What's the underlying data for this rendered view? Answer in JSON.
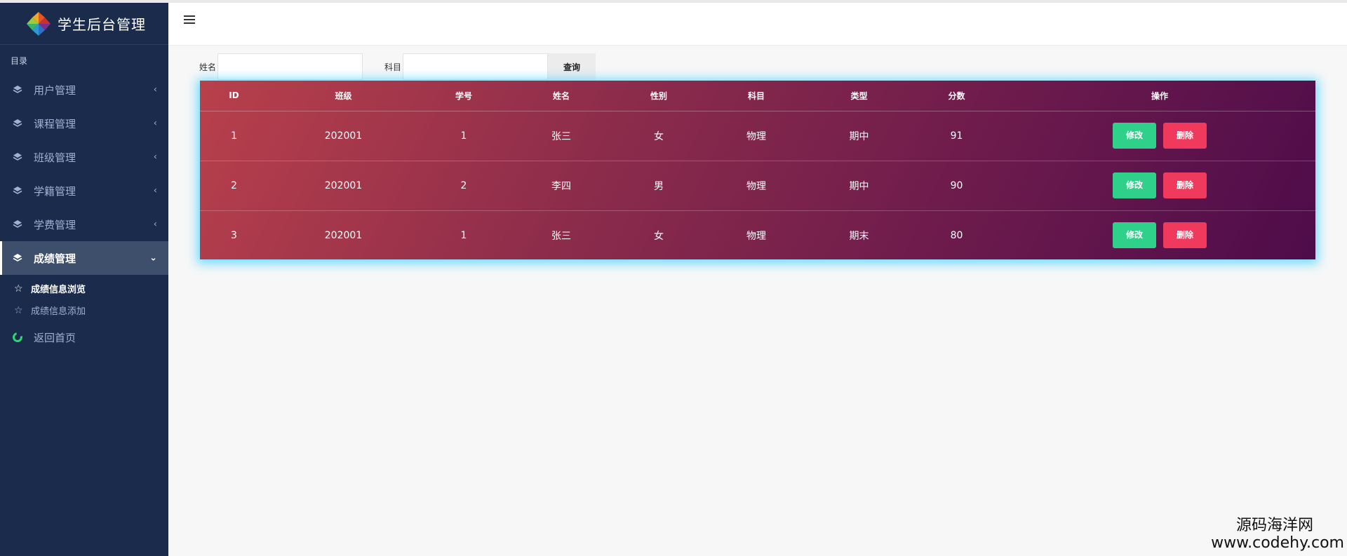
{
  "sidebar": {
    "brand_title": "学生后台管理",
    "menu_heading": "目录",
    "items": [
      {
        "label": "用户管理"
      },
      {
        "label": "课程管理"
      },
      {
        "label": "班级管理"
      },
      {
        "label": "学籍管理"
      },
      {
        "label": "学费管理"
      },
      {
        "label": "成绩管理"
      }
    ],
    "sub_items": [
      {
        "label": "成绩信息浏览"
      },
      {
        "label": "成绩信息添加"
      }
    ],
    "back_home": "返回首页"
  },
  "search": {
    "name_label": "姓名",
    "name_value": "",
    "subject_label": "科目",
    "subject_value": "",
    "query_button": "查询"
  },
  "table": {
    "headers": [
      "ID",
      "班级",
      "学号",
      "姓名",
      "性别",
      "科目",
      "类型",
      "分数",
      "操作"
    ],
    "rows": [
      {
        "id": "1",
        "class": "202001",
        "student_no": "1",
        "name": "张三",
        "gender": "女",
        "subject": "物理",
        "type": "期中",
        "score": "91"
      },
      {
        "id": "2",
        "class": "202001",
        "student_no": "2",
        "name": "李四",
        "gender": "男",
        "subject": "物理",
        "type": "期中",
        "score": "90"
      },
      {
        "id": "3",
        "class": "202001",
        "student_no": "1",
        "name": "张三",
        "gender": "女",
        "subject": "物理",
        "type": "期末",
        "score": "80"
      }
    ],
    "edit_label": "修改",
    "delete_label": "删除"
  },
  "watermark": {
    "cn": "源码海洋网",
    "url": "www.codehy.com"
  },
  "colors": {
    "sidebar_bg": "#1b2b4b",
    "edit_button": "#2ed08a",
    "delete_button": "#ef3a5d",
    "table_gradient_start": "#b8404b",
    "table_gradient_end": "#4e0c4a",
    "table_glow": "#40d2ff"
  },
  "icons": {
    "menu_item": "layers-icon",
    "collapse": "chevron-left-icon",
    "expanded": "chevron-down-icon",
    "sub_item": "star-icon",
    "back_home": "refresh-icon",
    "header_toggle": "hamburger-icon"
  }
}
